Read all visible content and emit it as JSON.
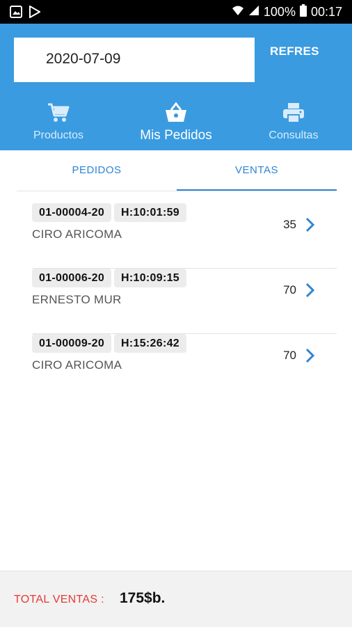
{
  "status_bar": {
    "battery": "100%",
    "time": "00:17",
    "left_icons": [
      "gallery-icon",
      "play-store-icon"
    ],
    "right_icons": [
      "wifi-icon",
      "signal-icon",
      "battery-icon"
    ]
  },
  "header": {
    "date": "2020-07-09",
    "refresh_label": "REFRES",
    "tabs": [
      {
        "label": "Productos",
        "icon": "cart-icon"
      },
      {
        "label": "Mis Pedidos",
        "icon": "basket-icon",
        "active": true
      },
      {
        "label": "Consultas",
        "icon": "printer-icon"
      }
    ]
  },
  "subtabs": [
    {
      "label": "PEDIDOS"
    },
    {
      "label": "VENTAS",
      "active": true
    }
  ],
  "orders": [
    {
      "code": "01-00004-20",
      "time": "H:10:01:59",
      "customer": "CIRO ARICOMA",
      "amount": "35"
    },
    {
      "code": "01-00006-20",
      "time": "H:10:09:15",
      "customer": "ERNESTO MUR",
      "amount": "70"
    },
    {
      "code": "01-00009-20",
      "time": "H:15:26:42",
      "customer": "CIRO ARICOMA",
      "amount": "70"
    }
  ],
  "footer": {
    "total_label": "TOTAL VENTAS :",
    "total_value": "175$b."
  },
  "colors": {
    "primary": "#3a9be0",
    "tab_text": "#2f84d3",
    "total_label": "#e53935"
  }
}
